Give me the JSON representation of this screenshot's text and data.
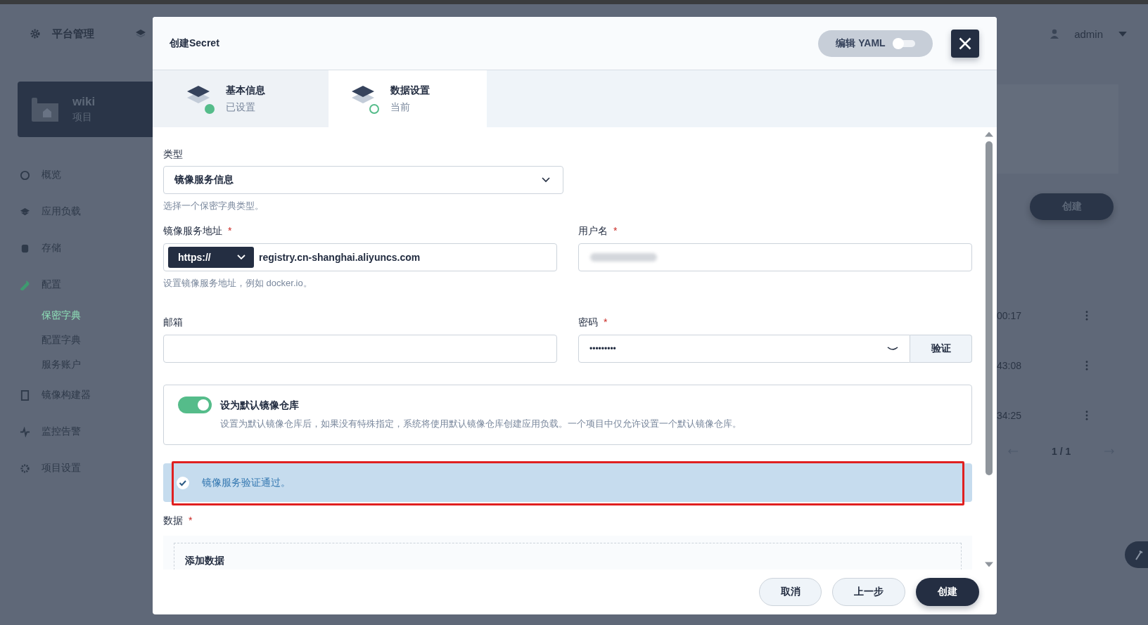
{
  "background": {
    "top_nav": {
      "platform_label": "平台管理",
      "user": "admin"
    },
    "project": {
      "name": "wiki",
      "type": "项目"
    },
    "menu": [
      {
        "label": "概览",
        "selected": false
      },
      {
        "label": "应用负载",
        "selected": false
      },
      {
        "label": "存储",
        "selected": false
      },
      {
        "label": "配置",
        "selected": true,
        "children": [
          {
            "label": "保密字典",
            "selected": true
          },
          {
            "label": "配置字典",
            "selected": false
          },
          {
            "label": "服务账户",
            "selected": false
          }
        ]
      },
      {
        "label": "镜像构建器",
        "selected": false
      },
      {
        "label": "监控告警",
        "selected": false
      },
      {
        "label": "项目设置",
        "selected": false
      }
    ],
    "create_button": "创建",
    "table_times": [
      "00:17",
      "43:08",
      "34:25"
    ],
    "pagination": "1 / 1"
  },
  "dialog": {
    "title": "创建Secret",
    "yaml_toggle": {
      "label": "编辑 YAML",
      "on": false
    },
    "steps": [
      {
        "title": "基本信息",
        "subtitle": "已设置",
        "done": true,
        "selected": false
      },
      {
        "title": "数据设置",
        "subtitle": "当前",
        "done": false,
        "selected": true
      }
    ],
    "type_field": {
      "label": "类型",
      "value": "镜像服务信息",
      "hint": "选择一个保密字典类型。"
    },
    "registry_field": {
      "label": "镜像服务地址",
      "required_mark": "*",
      "protocol": "https://",
      "value": "registry.cn-shanghai.aliyuncs.com",
      "hint": "设置镜像服务地址，例如 docker.io。"
    },
    "username_field": {
      "label": "用户名",
      "required_mark": "*"
    },
    "email_field": {
      "label": "邮箱"
    },
    "password_field": {
      "label": "密码",
      "required_mark": "*",
      "value": "•••••••••",
      "verify_button": "验证"
    },
    "default_registry": {
      "on": true,
      "title": "设为默认镜像仓库",
      "description": "设置为默认镜像仓库后，如果没有特殊指定，系统将使用默认镜像仓库创建应用负载。一个项目中仅允许设置一个默认镜像仓库。"
    },
    "alert": {
      "kind": "success",
      "text": "镜像服务验证通过。"
    },
    "data_section": {
      "label": "数据",
      "required_mark": "*",
      "add_label": "添加数据"
    },
    "buttons": [
      {
        "label": "取消",
        "kind": "secondary"
      },
      {
        "label": "上一步",
        "kind": "secondary"
      },
      {
        "label": "创建",
        "kind": "primary"
      }
    ]
  }
}
